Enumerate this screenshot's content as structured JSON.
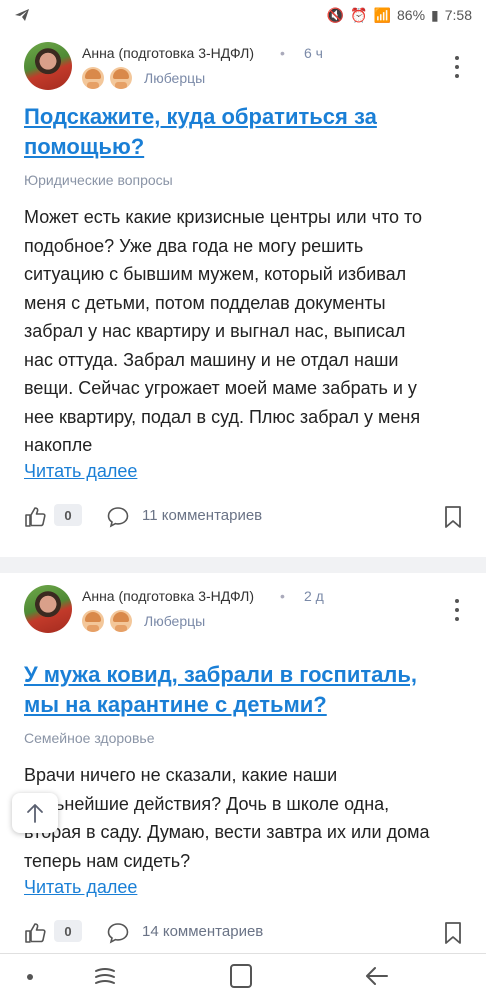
{
  "status_bar": {
    "battery": "86%",
    "time": "7:58"
  },
  "posts": [
    {
      "author": "Анна (подготовка 3-НДФЛ)",
      "time": "6 ч",
      "city": "Люберцы",
      "title_line1": "Подскажите, куда обратиться за",
      "title_line2": "помощью?",
      "category": "Юридические вопросы",
      "body_lines": [
        "Может есть какие кризисные центры или что то",
        "подобное? Уже два года не могу решить",
        "ситуацию с бывшим мужем, который избивал",
        "меня с детьми, потом подделав документы",
        "забрал у нас квартиру и выгнал нас, выписал",
        "нас оттуда. Забрал машину и не отдал наши",
        "вещи. Сейчас угрожает моей маме забрать и у",
        "нее квартиру, подал в суд. Плюс забрал у меня",
        "накопле"
      ],
      "read_more": "Читать далее",
      "likes": "0",
      "comments": "11 комментариев"
    },
    {
      "author": "Анна (подготовка 3-НДФЛ)",
      "time": "2 д",
      "city": "Люберцы",
      "title_line1": "У мужа ковид, забрали в госпиталь,",
      "title_line2": "мы на карантине с детьми?",
      "category": "Семейное здоровье",
      "body_lines": [
        "Врачи ничего не сказали, какие наши",
        "дальнейшие действия? Дочь в школе одна,",
        "вторая в саду. Думаю, вести завтра их или дома",
        "теперь нам сидеть?"
      ],
      "read_more": "Читать далее",
      "likes": "0",
      "comments": "14 комментариев"
    }
  ],
  "icons": {
    "like": "thumbs-up-icon",
    "comment": "comment-bubble-icon",
    "bookmark": "bookmark-icon",
    "more": "more-vertical-icon",
    "scroll_top": "arrow-up-icon"
  },
  "colors": {
    "accent": "#1a7fd6",
    "muted": "#7b8aa8",
    "background": "#f1f2f4"
  }
}
